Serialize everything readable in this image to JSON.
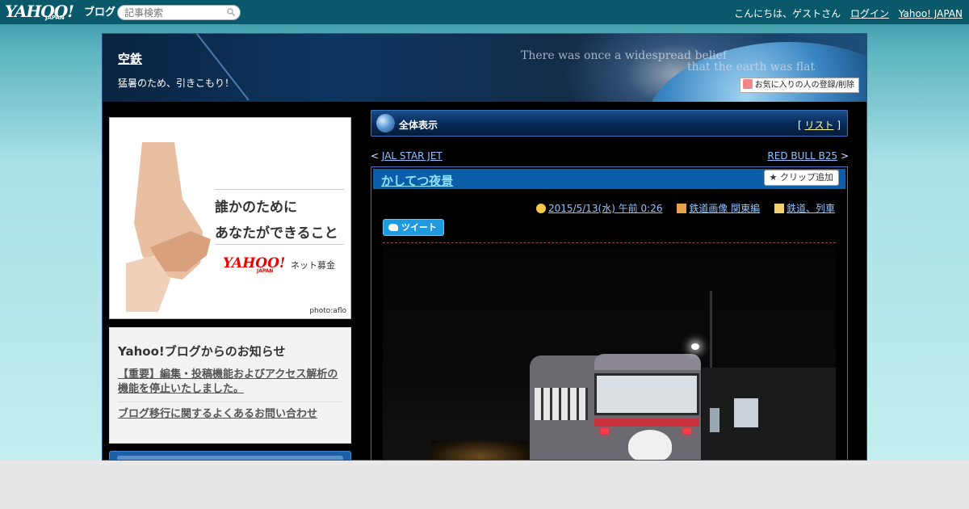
{
  "topbar": {
    "logo_text": "YAHOO!",
    "logo_sub": "JAPAN",
    "logo_suffix": "ブログ",
    "search_placeholder": "記事検索",
    "greeting": "こんにちは、ゲストさん",
    "login_label": "ログイン",
    "portal_label": "Yahoo! JAPAN"
  },
  "header": {
    "blog_title": "空鉄",
    "blog_description": "猛暑のため、引きこもり！",
    "banner_text_1": "There was once a widespread belief",
    "banner_text_2": "that the earth was flat",
    "favorite_button_label": "お気に入りの人の登録/削除"
  },
  "ad": {
    "line1": "誰かのために",
    "line2": "あなたができること",
    "brand": "YAHOO!",
    "brand_sub": "JAPAN",
    "service": "ネット募金",
    "credit": "photo:aflo"
  },
  "notice": {
    "heading": "Yahoo!ブログからのお知らせ",
    "links": [
      "【重要】編集・投稿機能およびアクセス解析の機能を停止いたしました。",
      "ブログ移行に関するよくあるお問い合わせ"
    ]
  },
  "view_bar": {
    "label": "全体表示",
    "list_open": "[",
    "list_label": "リスト",
    "list_close": "]"
  },
  "navigation": {
    "prev_marker": "<",
    "prev_label": "JAL STAR JET",
    "next_label": "RED BULL B25",
    "next_marker": ">"
  },
  "article": {
    "title": "かしてつ夜景",
    "clip_button_label": "クリップ追加",
    "date": "2015/5/13(水) 午前 0:26",
    "category": "鉄道画像 関東編",
    "tag": "鉄道、列車",
    "tweet_label": "ツイート"
  },
  "colors": {
    "topbar": "#09596b",
    "frame_border": "#2a4b8c",
    "link_blue": "#8ec3ff",
    "title_bar": "#0b5eaa",
    "tweet_blue": "#1e9adf"
  }
}
